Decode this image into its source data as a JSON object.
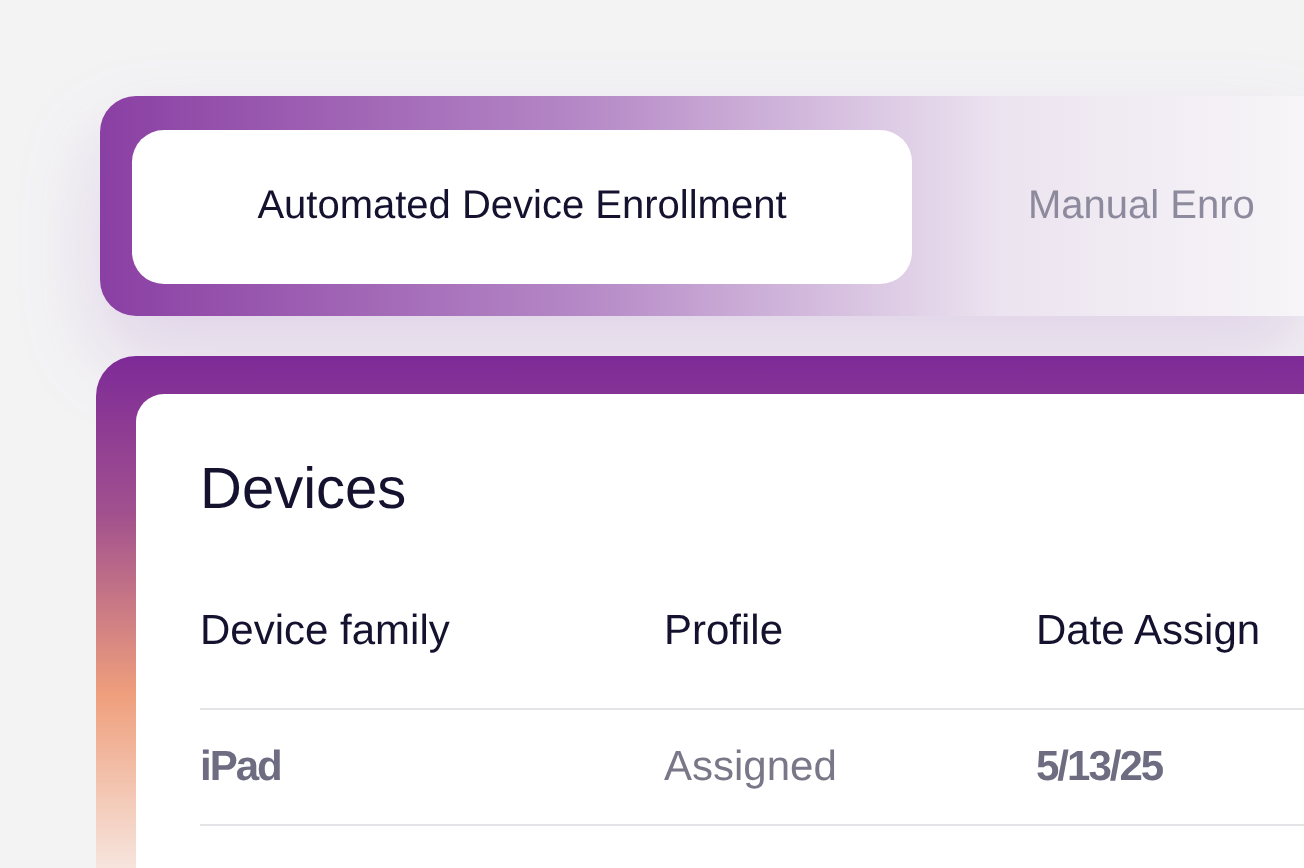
{
  "tabs": [
    {
      "label": "Automated Device Enrollment",
      "selected": true
    },
    {
      "label": "Manual Enro",
      "selected": false
    }
  ],
  "devices": {
    "title": "Devices",
    "columns": [
      "Device family",
      "Profile",
      "Date Assign"
    ],
    "rows": [
      [
        "iPad",
        "Assigned",
        "5/13/25"
      ]
    ]
  }
}
